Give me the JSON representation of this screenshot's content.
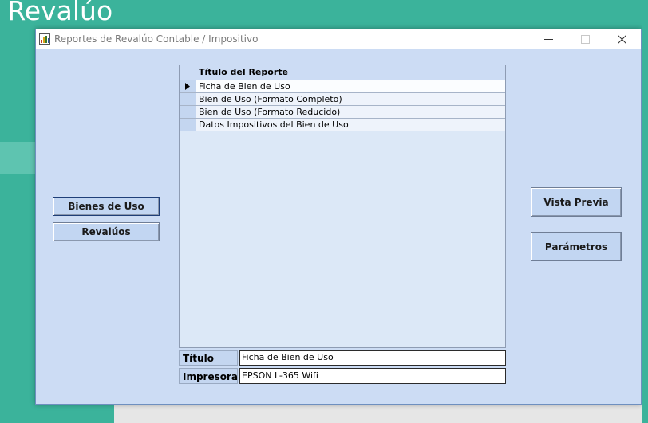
{
  "background": {
    "app_title": ") Revalúo"
  },
  "window": {
    "title": "Reportes de Revalúo Contable / Impositivo",
    "controls": [
      "minimize",
      "maximize",
      "close"
    ]
  },
  "left_buttons": {
    "bienes_de_uso": "Bienes de Uso",
    "revaluos": "Revalúos"
  },
  "right_buttons": {
    "vista_previa": "Vista Previa",
    "parametros": "Parámetros"
  },
  "grid": {
    "column_header": "Título del Reporte",
    "rows": [
      "Ficha de Bien de Uso",
      "Bien de Uso (Formato Completo)",
      "Bien de Uso (Formato Reducido)",
      "Datos Impositivos del Bien de Uso"
    ],
    "selected_row": 0
  },
  "fields": {
    "titulo_label": "Título",
    "titulo_value": "Ficha de Bien de Uso",
    "impresora_label": "Impresora",
    "impresora_value": "EPSON L-365 Wifi"
  },
  "colors": {
    "app_background": "#3bb39b",
    "window_background": "#ccdcf4",
    "button_face": "#c2d6f2"
  }
}
